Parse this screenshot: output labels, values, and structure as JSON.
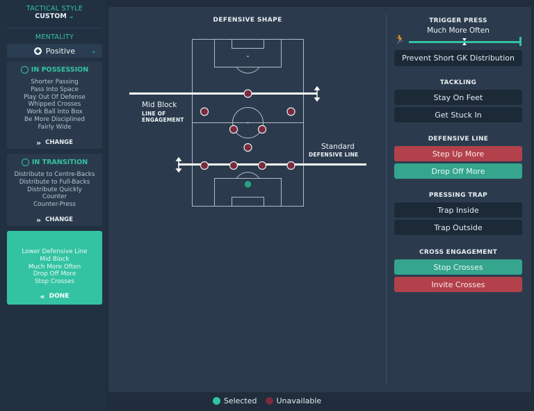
{
  "sidebar": {
    "tactical_style_label": "TACTICAL STYLE",
    "tactical_style_value": "CUSTOM",
    "mentality_label": "MENTALITY",
    "mentality_value": "Positive",
    "in_possession": {
      "title": "IN POSSESSION",
      "items": [
        "Shorter Passing",
        "Pass Into Space",
        "Play Out Of Defense",
        "Whipped Crosses",
        "Work Ball Into Box",
        "Be More Disciplined",
        "Fairly Wide"
      ],
      "change_label": "CHANGE"
    },
    "in_transition": {
      "title": "IN TRANSITION",
      "items": [
        "Distribute to Centre-Backs",
        "Distribute to Full-Backs",
        "Distribute Quickly",
        "Counter",
        "Counter-Press"
      ],
      "change_label": "CHANGE"
    },
    "out_of_possession": {
      "items": [
        "Lower Defensive Line",
        "Mid Block",
        "Much More Often",
        "Drop Off More",
        "Stop Crosses"
      ],
      "done_label": "DONE"
    }
  },
  "pitch": {
    "title": "DEFENSIVE SHAPE",
    "engagement_value": "Mid Block",
    "engagement_caption_1": "LINE OF",
    "engagement_caption_2": "ENGAGEMENT",
    "defensive_line_value": "Standard",
    "defensive_line_caption": "DEFENSIVE LINE"
  },
  "right": {
    "trigger_press": {
      "title": "TRIGGER PRESS",
      "value": "Much More Often",
      "level": 0.9
    },
    "prevent_short_gk": "Prevent Short GK Distribution",
    "tackling": {
      "title": "TACKLING",
      "options": [
        "Stay On Feet",
        "Get Stuck In"
      ]
    },
    "defensive_line": {
      "title": "DEFENSIVE LINE",
      "options": [
        "Step Up More",
        "Drop Off More"
      ]
    },
    "pressing_trap": {
      "title": "PRESSING TRAP",
      "options": [
        "Trap Inside",
        "Trap Outside"
      ]
    },
    "cross_engagement": {
      "title": "CROSS ENGAGEMENT",
      "options": [
        "Stop Crosses",
        "Invite Crosses"
      ]
    }
  },
  "legend": {
    "selected": "Selected",
    "unavailable": "Unavailable"
  },
  "colors": {
    "teal": "#34c3a2",
    "maroon": "#7a2a3d",
    "red_button": "#b2414c",
    "green_button": "#35a58d"
  }
}
